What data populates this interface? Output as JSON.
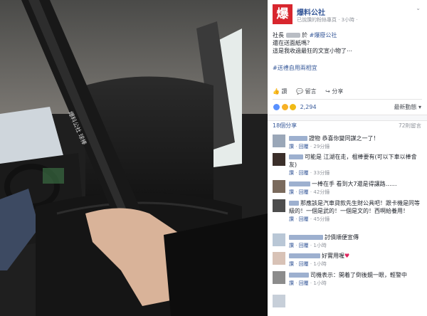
{
  "post": {
    "page_name": "爆料公社",
    "logo_char": "爆",
    "meta": "已說讚的粉絲專頁 · 3小時 ·",
    "text_line1_pre": "社長",
    "text_line1_mid": "於",
    "text_line1_tag": "#爆廢公社",
    "text_line2": "還在送面紙嗎？",
    "text_line3": "這是我收過最狂的文宣小物了⋯",
    "hashtag": "#送禮自用兩相宜",
    "chevron": "⌄"
  },
  "actions": {
    "like": "讚",
    "comment": "留言",
    "share": "分享"
  },
  "reactions": {
    "count": "2,294",
    "sort_label": "最新動態 ▾"
  },
  "shares_label": "18個分享",
  "comments_count": "72則留言",
  "comments": [
    {
      "text": "證物 恭喜你變同謀之一了！",
      "like": "讚",
      "reply": "回覆",
      "time": "29分鐘"
    },
    {
      "text": "可能是 江湖在走，棍棒要有(可以下車以棒會友)",
      "like": "讚",
      "reply": "回覆",
      "time": "33分鐘"
    },
    {
      "text": "一棒在手 看到大7還是得讓路……",
      "like": "讚",
      "reply": "回覆",
      "time": "42分鐘"
    },
    {
      "text": "那應該是汽車貸款先生財公具吧！跟卡機是同等級的！一個是武的！一個是文的！西啊給養用！",
      "like": "讚",
      "reply": "回覆",
      "time": "45分鐘"
    },
    {
      "text": "討債順便宣傳",
      "like": "讚",
      "reply": "回覆",
      "time": "1小時"
    },
    {
      "text": "好實用喔",
      "like": "讚",
      "reply": "回覆",
      "time": "1小時"
    },
    {
      "text": "司機表示：開着了倒後鏡一眼，輕警中",
      "like": "讚",
      "reply": "回覆",
      "time": "1小時"
    }
  ],
  "photo": {
    "bat_text": "爆料公社 球棒"
  },
  "colors": {
    "brand_red": "#d8262e",
    "link_blue": "#365899",
    "grey_text": "#90949c"
  }
}
